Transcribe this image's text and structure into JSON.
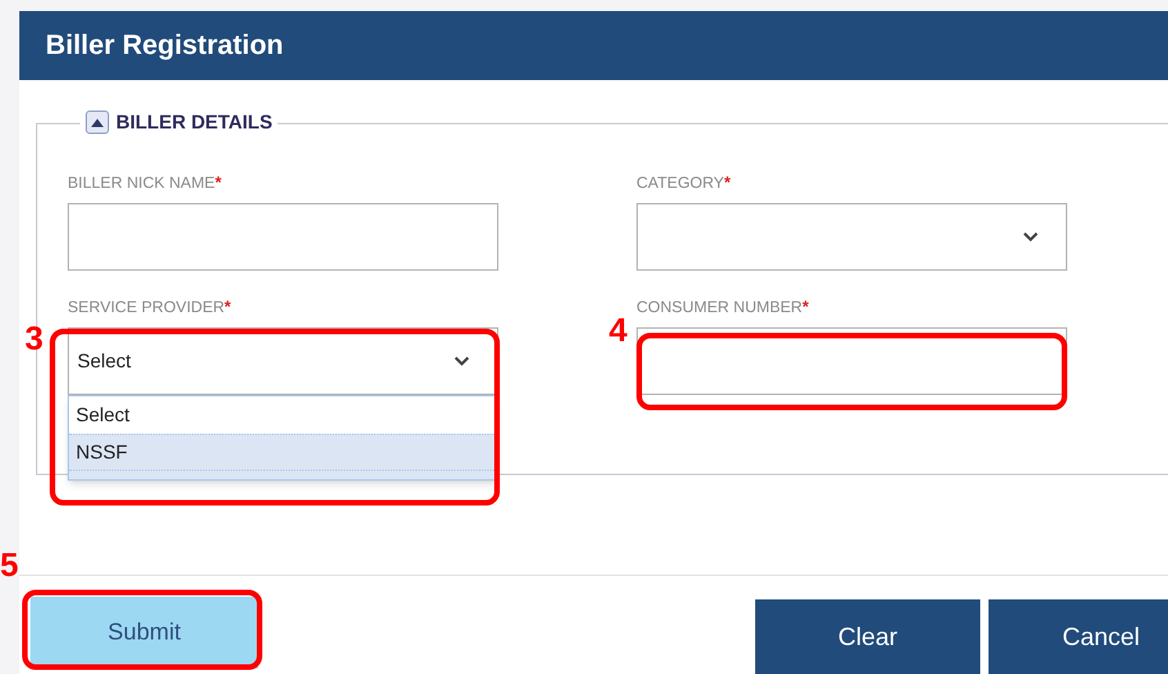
{
  "window": {
    "title": "Biller Registration"
  },
  "section": {
    "title": "BILLER DETAILS",
    "expanded": true
  },
  "fields": [
    {
      "label": "BILLER NICK NAME",
      "required": true,
      "required_mark": "*",
      "kind": "text"
    },
    {
      "label": "CATEGORY",
      "required": true,
      "required_mark": "*",
      "kind": "select"
    },
    {
      "label": "SERVICE PROVIDER",
      "required": true,
      "required_mark": "*",
      "kind": "select",
      "value": "Select",
      "options": [
        {
          "label": "Select",
          "highlighted": false
        },
        {
          "label": "NSSF",
          "highlighted": true
        }
      ]
    },
    {
      "label": "CONSUMER NUMBER",
      "required": true,
      "required_mark": "*",
      "kind": "text"
    }
  ],
  "buttons": [
    {
      "label": "Submit",
      "kind": "primary"
    },
    {
      "label": "Clear",
      "kind": "secondary"
    },
    {
      "label": "Cancel",
      "kind": "secondary"
    }
  ],
  "annotations": [
    {
      "label": "3"
    },
    {
      "label": "4"
    },
    {
      "label": "5"
    }
  ]
}
